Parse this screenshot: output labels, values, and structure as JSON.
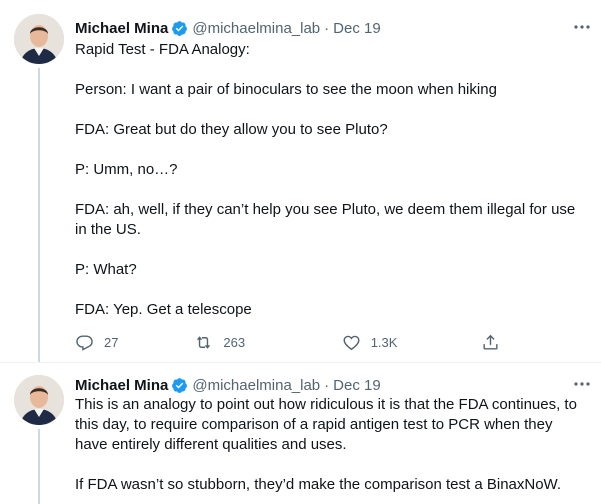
{
  "tweets": [
    {
      "author": "Michael Mina",
      "handle": "@michaelmina_lab",
      "date": "Dec 19",
      "paragraphs": [
        "Rapid Test - FDA Analogy:",
        "Person: I want a pair of binoculars to see the moon when hiking",
        "FDA: Great but do they allow you to see Pluto?",
        "P: Umm, no…?",
        "FDA: ah, well, if they can’t help you see Pluto, we deem them illegal for use in the US.",
        "P: What?",
        "FDA: Yep. Get a telescope"
      ],
      "actions": {
        "replies": "27",
        "retweets": "263",
        "likes": "1.3K"
      }
    },
    {
      "author": "Michael Mina",
      "handle": "@michaelmina_lab",
      "date": "Dec 19",
      "paragraphs": [
        "This is an analogy to point out how ridiculous it is that the FDA continues, to this day, to require comparison of a rapid antigen test to PCR when they have entirely different qualities and uses.",
        "If FDA wasn’t so stubborn, they’d make the comparison test a BinaxNoW."
      ]
    }
  ],
  "colors": {
    "text": "#0f1419",
    "secondary": "#536471",
    "verified": "#1d9bf0",
    "divider": "#eff3f4",
    "thread_line": "#cfd9de"
  },
  "icons": [
    "avatar",
    "verified-badge-icon",
    "more-icon",
    "reply-icon",
    "retweet-icon",
    "like-icon",
    "share-icon"
  ]
}
